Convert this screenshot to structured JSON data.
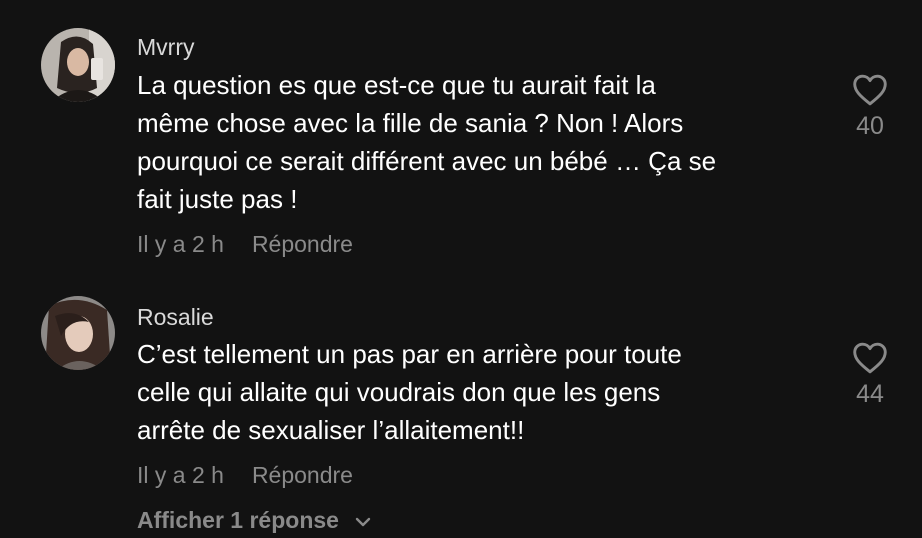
{
  "comments": [
    {
      "username": "Mvrry",
      "text": "La question es que est-ce que tu aurait fait la\nmême chose avec la fille de sania ? Non ! Alors\npourquoi ce serait différent avec un bébé … Ça se\nfait juste pas !",
      "time": "Il y a 2 h",
      "reply": "Répondre",
      "likes": "40"
    },
    {
      "username": "Rosalie",
      "text": "C’est tellement un pas par en arrière pour toute\ncelle qui allaite qui voudrais don que les gens\narrête de sexualiser l’allaitement!!",
      "time": "Il y a 2 h",
      "reply": "Répondre",
      "likes": "44"
    }
  ],
  "show_replies": "Afficher 1 réponse",
  "colors": {
    "background": "#121212",
    "text": "#ffffff",
    "muted": "#8a8a8a"
  },
  "icons": [
    "heart-icon",
    "chevron-down-icon"
  ]
}
